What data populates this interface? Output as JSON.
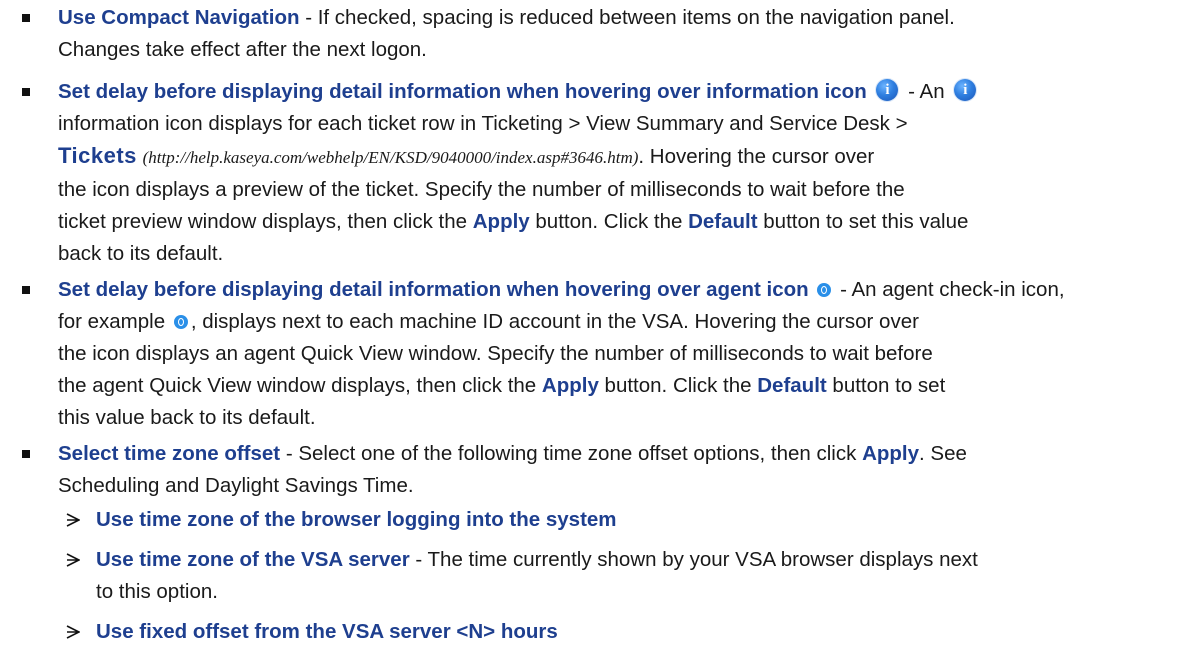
{
  "items": [
    {
      "term": "Use Compact Navigation",
      "desc_line1": " - If checked, spacing is reduced between items on the navigation panel.",
      "desc_line2": "Changes take effect after the next logon."
    },
    {
      "term": "Set delay before displaying detail information when hovering over information icon",
      "dash": " - An ",
      "line2": "information icon displays for each ticket row in Ticketing > View Summary and Service Desk >",
      "link": "Tickets",
      "url": "(http://help.kaseya.com/webhelp/EN/KSD/9040000/index.asp#3646.htm)",
      "after_url": ". Hovering the cursor over",
      "line4": "the icon displays a preview of the ticket. Specify the number of milliseconds to wait before the",
      "line5a": "ticket preview window displays, then click the ",
      "apply": "Apply",
      "line5b": " button. Click the ",
      "default": "Default",
      "line5c": " button to set this value",
      "line6": "back to its default."
    },
    {
      "term": "Set delay before displaying detail information when hovering over agent icon",
      "dash": " - An agent check-in icon,",
      "line2a": "for example ",
      "line2b": ", displays next to each machine ID account in the VSA. Hovering the cursor over",
      "line3": "the icon displays an agent Quick View window. Specify the number of milliseconds to wait before",
      "line4a": "the agent Quick View window displays, then click the ",
      "apply": "Apply",
      "line4b": " button. Click the ",
      "default": "Default",
      "line4c": " button to set",
      "line5": "this value back to its default."
    },
    {
      "term": "Select time zone offset",
      "desc_a": " - Select one of the following time zone offset options, then click ",
      "apply": "Apply",
      "desc_b": ". See",
      "line2": "Scheduling and Daylight Savings Time."
    }
  ],
  "subitems": [
    {
      "term": "Use time zone of the browser logging into the system"
    },
    {
      "term": "Use time zone of the VSA server",
      "desc": " - The time currently shown by your VSA browser displays next",
      "line2": "to this option."
    },
    {
      "term": "Use fixed offset from the VSA server <N> hours"
    }
  ],
  "icons": {
    "info": "info-circle-icon",
    "agent": "agent-checkin-icon",
    "bullet": "square-bullet-icon",
    "arrow": "arrow-bullet-icon"
  },
  "colors": {
    "term": "#1e3f8f",
    "info_icon": "#2f7fe0",
    "agent_icon": "#2a8fe8"
  }
}
